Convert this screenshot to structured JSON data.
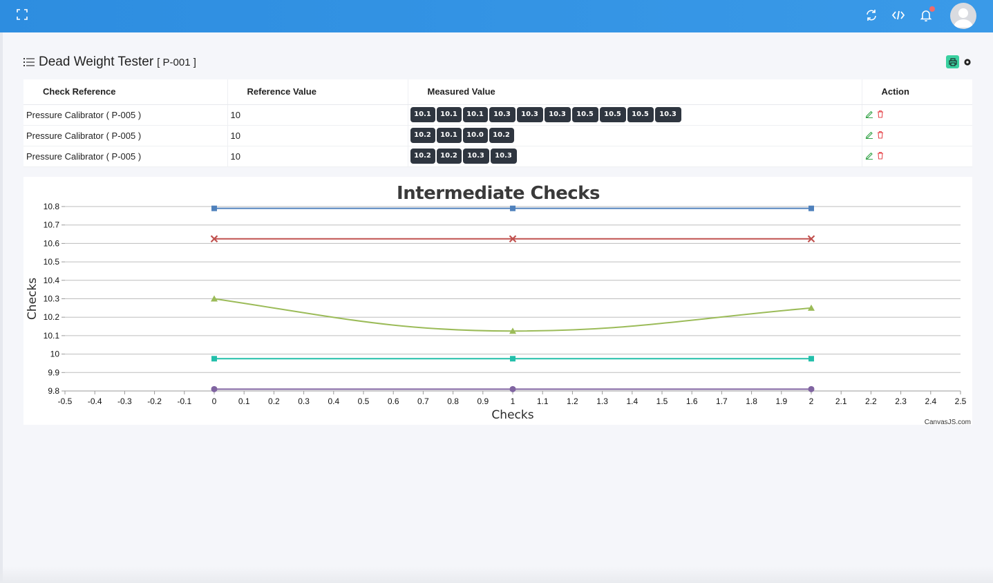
{
  "topbar": {
    "icons": [
      "expand-icon",
      "refresh-icon",
      "code-icon",
      "bell-icon",
      "avatar-icon"
    ],
    "accent": "#3a9ae8",
    "notification_dot_color": "#f06b6b"
  },
  "header": {
    "title": "Dead Weight Tester",
    "code": "[ P-001 ]",
    "icons": [
      "list-icon",
      "print-icon",
      "gear-icon"
    ]
  },
  "table": {
    "columns": [
      "Check Reference",
      "Reference Value",
      "Measured Value",
      "Action"
    ],
    "rows": [
      {
        "reference": "Pressure Calibrator ( P-005 )",
        "ref_value": "10",
        "measured": [
          "10.1",
          "10.1",
          "10.1",
          "10.3",
          "10.3",
          "10.3",
          "10.5",
          "10.5",
          "10.5",
          "10.3"
        ]
      },
      {
        "reference": "Pressure Calibrator ( P-005 )",
        "ref_value": "10",
        "measured": [
          "10.2",
          "10.1",
          "10.0",
          "10.2"
        ]
      },
      {
        "reference": "Pressure Calibrator ( P-005 )",
        "ref_value": "10",
        "measured": [
          "10.2",
          "10.2",
          "10.3",
          "10.3"
        ]
      }
    ],
    "action_icons": [
      "edit-icon",
      "delete-icon"
    ],
    "badge_color": "#2f3640"
  },
  "chart_data": {
    "type": "line",
    "title": "Intermediate Checks",
    "xlabel": "Checks",
    "ylabel": "Checks",
    "credit": "CanvasJS.com",
    "xlim": [
      -0.5,
      2.5
    ],
    "ylim": [
      9.8,
      10.8
    ],
    "xticks": [
      "-0.5",
      "-0.4",
      "-0.3",
      "-0.2",
      "-0.1",
      "0",
      "0.1",
      "0.2",
      "0.3",
      "0.4",
      "0.5",
      "0.6",
      "0.7",
      "0.8",
      "0.9",
      "1",
      "1.1",
      "1.2",
      "1.3",
      "1.4",
      "1.5",
      "1.6",
      "1.7",
      "1.8",
      "1.9",
      "2",
      "2.1",
      "2.2",
      "2.3",
      "2.4",
      "2.5"
    ],
    "yticks": [
      "9.8",
      "9.9",
      "10",
      "10.1",
      "10.2",
      "10.3",
      "10.4",
      "10.5",
      "10.6",
      "10.7",
      "10.8"
    ],
    "grid": true,
    "series": [
      {
        "x": [
          0,
          1,
          2
        ],
        "values": [
          10.79,
          10.79,
          10.79
        ],
        "color": "#4f81bc",
        "marker": "square",
        "smooth": false
      },
      {
        "x": [
          0,
          1,
          2
        ],
        "values": [
          10.625,
          10.625,
          10.625
        ],
        "color": "#c0504e",
        "marker": "cross",
        "smooth": false
      },
      {
        "x": [
          0,
          1,
          2
        ],
        "values": [
          10.3,
          10.125,
          10.25
        ],
        "color": "#9bbb58",
        "marker": "triangle",
        "smooth": true
      },
      {
        "x": [
          0,
          1,
          2
        ],
        "values": [
          9.975,
          9.975,
          9.975
        ],
        "color": "#23bfaa",
        "marker": "square",
        "smooth": false
      },
      {
        "x": [
          0,
          1,
          2
        ],
        "values": [
          9.81,
          9.81,
          9.81
        ],
        "color": "#8064a1",
        "marker": "circle",
        "smooth": false
      }
    ]
  }
}
